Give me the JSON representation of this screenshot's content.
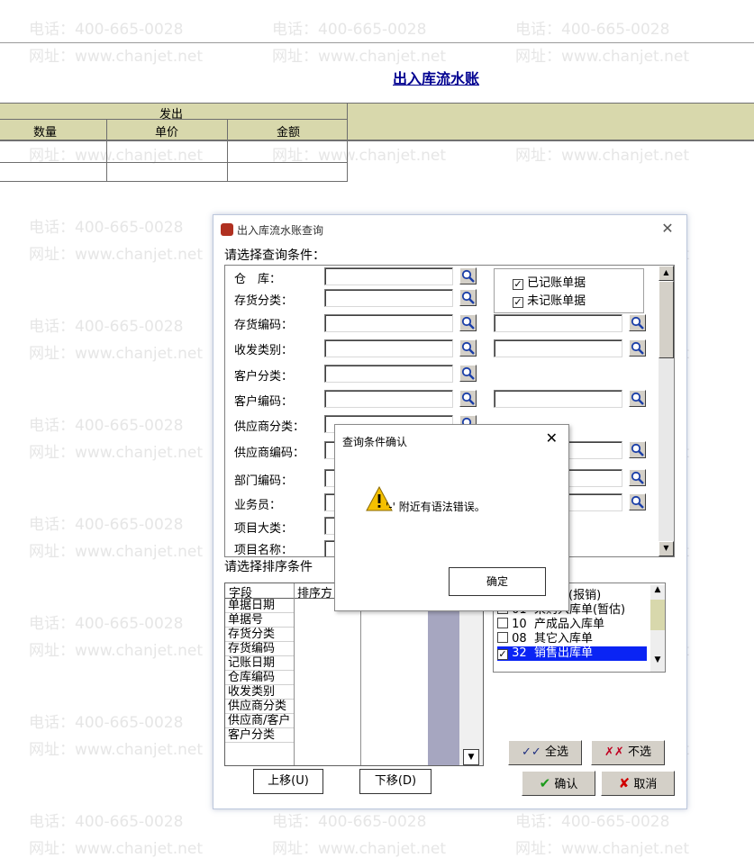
{
  "watermark": {
    "phone": "电话：400-665-0028",
    "web": "网址：www.chanjet.net"
  },
  "report": {
    "title": "出入库流水账",
    "group_header": "发出",
    "columns": [
      "数量",
      "单价",
      "金额"
    ]
  },
  "dialog": {
    "title": "出入库流水账查询",
    "close_icon": "close-icon",
    "condition_label": "请选择查询条件：",
    "conditions": [
      "仓　库：",
      "存货分类：",
      "存货编码：",
      "收发类别：",
      "客户分类：",
      "客户编码：",
      "供应商分类：",
      "供应商编码：",
      "部门编码：",
      "业务员：",
      "项目大类：",
      "项目名称："
    ],
    "checkbox_posted": "已记账单据",
    "checkbox_unposted": "未记账单据",
    "sort_label": "请选择排序条件",
    "sort_header_field": "字段",
    "sort_header_order": "排序方",
    "sort_fields": [
      "单据日期",
      "单据号",
      "存货分类",
      "存货编码",
      "记账日期",
      "仓库编码",
      "收发类别",
      "供应商分类",
      "供应商/客户",
      "客户分类"
    ],
    "doc_types": [
      {
        "code": "",
        "name": "入库单(报销)",
        "checked": false
      },
      {
        "code": "01",
        "name": "采购入库单(暂估)",
        "checked": false
      },
      {
        "code": "10",
        "name": "产成品入库单",
        "checked": false
      },
      {
        "code": "08",
        "name": "其它入库单",
        "checked": false
      },
      {
        "code": "32",
        "name": "销售出库单",
        "checked": true
      }
    ],
    "select_all": "全选",
    "select_none": "不选",
    "move_up": "上移(U)",
    "move_down": "下移(D)",
    "ok": "确认",
    "cancel": "取消"
  },
  "message_box": {
    "title": "查询条件确认",
    "text": "'-' 附近有语法错误。",
    "ok": "确定"
  },
  "colors": {
    "report_title": "#000090",
    "header_band": "#d8d8ac",
    "selection": "#0a24f4"
  }
}
